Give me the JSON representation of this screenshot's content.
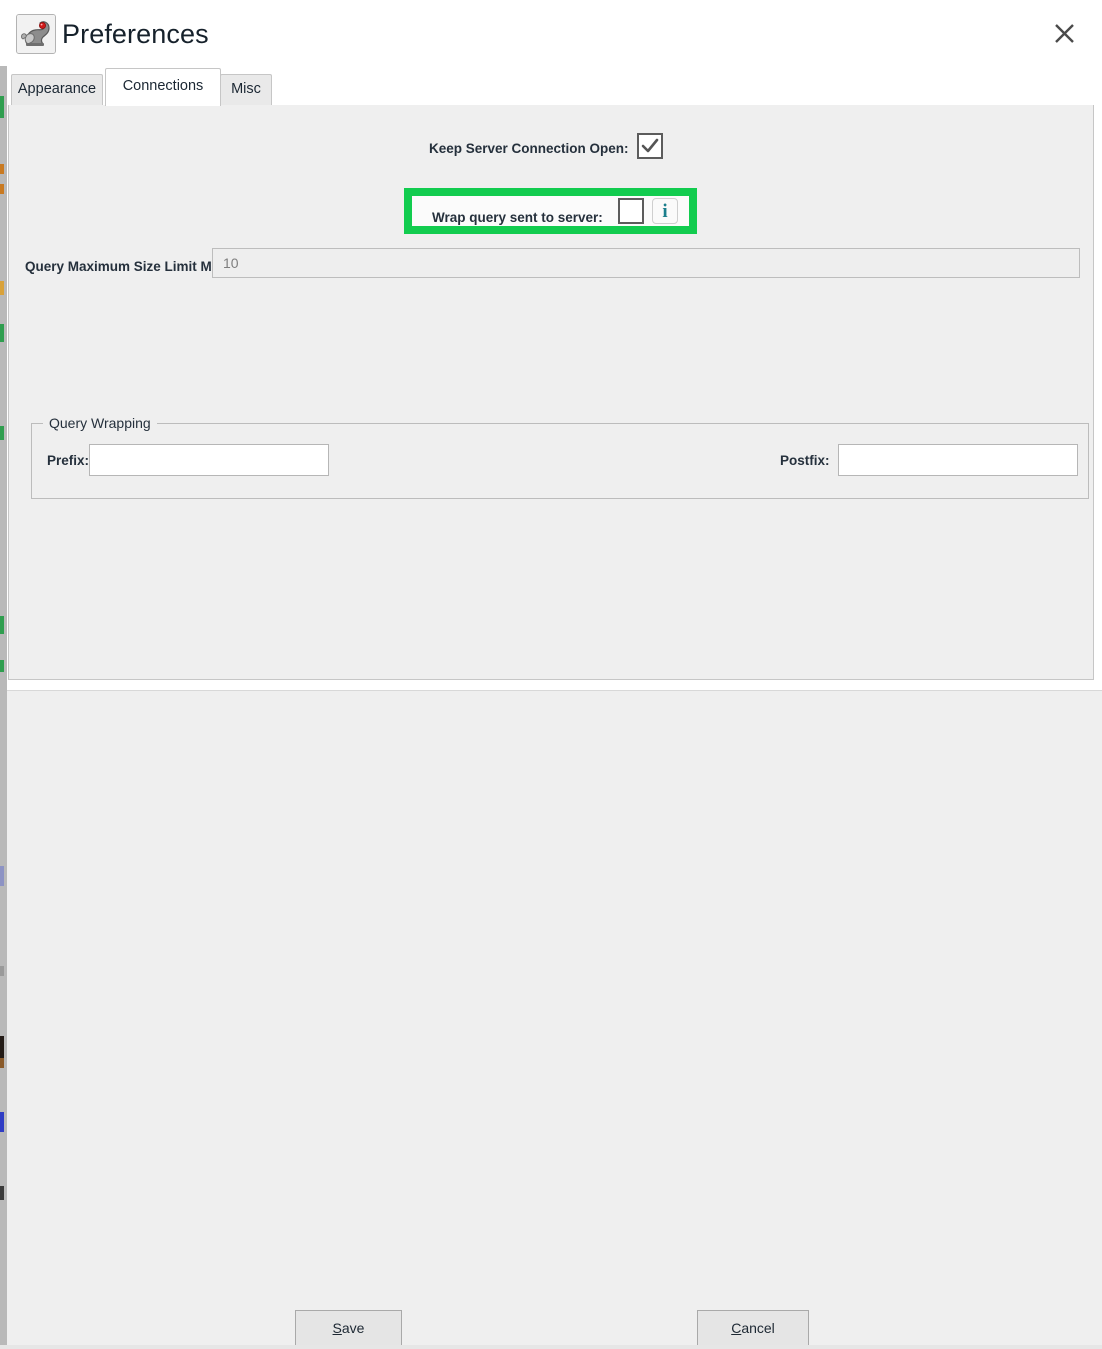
{
  "window": {
    "title": "Preferences",
    "app_icon": "squirrel-app-icon",
    "close_icon": "close-icon"
  },
  "tabs": [
    {
      "label": "Appearance",
      "selected": false
    },
    {
      "label": "Connections",
      "selected": true
    },
    {
      "label": "Misc",
      "selected": false
    }
  ],
  "connections": {
    "keep_open": {
      "label": "Keep Server Connection Open:",
      "checked": true,
      "check_icon": "checkmark-icon"
    },
    "wrap_query": {
      "label": "Wrap query sent to server:",
      "checked": false,
      "info_icon": "info-icon",
      "info_glyph": "i",
      "highlighted": true,
      "highlight_color": "#12cc4f"
    },
    "max_size": {
      "label": "Query Maximum Size Limit MB:",
      "value": "10",
      "placeholder": ""
    },
    "query_wrapping": {
      "title": "Query Wrapping",
      "prefix": {
        "label": "Prefix:",
        "value": "",
        "placeholder": ""
      },
      "postfix": {
        "label": "Postfix:",
        "value": "",
        "placeholder": ""
      }
    }
  },
  "footer": {
    "save": {
      "label": "Save",
      "mnemonic": "S",
      "rest": "ave"
    },
    "cancel": {
      "label": "Cancel",
      "mnemonic": "C",
      "rest": "ancel"
    }
  }
}
